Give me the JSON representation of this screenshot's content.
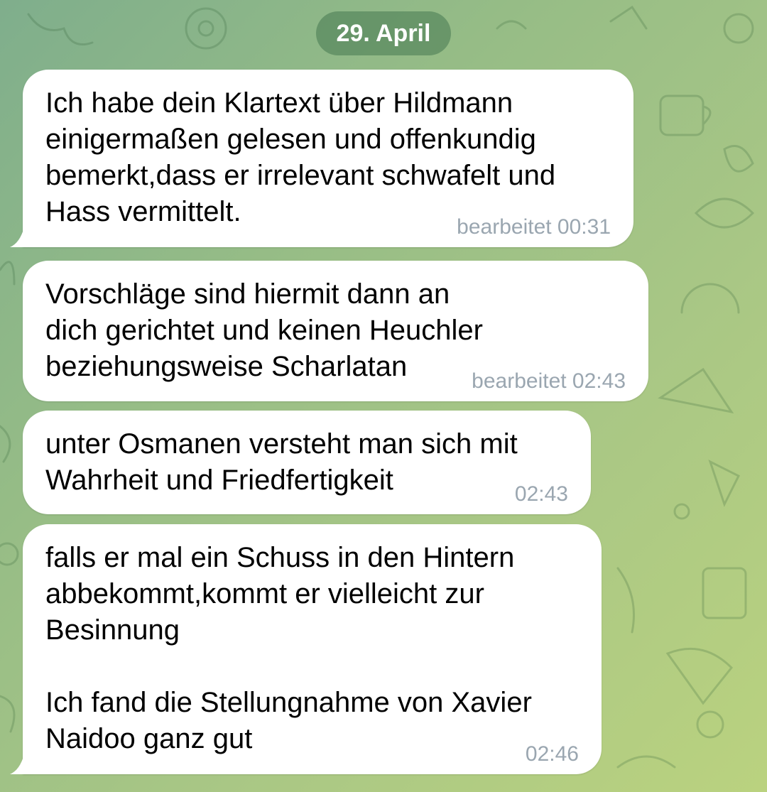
{
  "chat": {
    "date_label": "29. April",
    "messages": [
      {
        "text": "Ich habe dein Klartext über Hildmann einigermaßen gelesen und offenkundig bemerkt,dass er irrelevant schwafelt und Hass vermittelt.",
        "meta": "bearbeitet 00:31"
      },
      {
        "text": "Vorschläge sind hiermit dann an dich gerichtet und keinen Heuchler beziehungsweise Scharlatan",
        "meta": "bearbeitet 02:43"
      },
      {
        "text": "unter Osmanen versteht man sich mit Wahrheit und Friedfertigkeit",
        "meta": "02:43"
      },
      {
        "text": "falls er mal ein Schuss in den Hintern abbekommt,kommt er vielleicht zur Besinnung\n\nIch fand die Stellungnahme von Xavier Naidoo ganz gut",
        "meta": "02:46"
      }
    ]
  }
}
